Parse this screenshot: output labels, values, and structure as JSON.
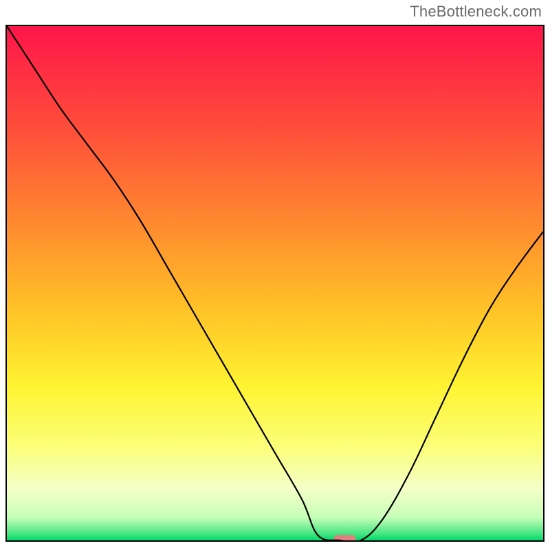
{
  "watermark": "TheBottleneck.com",
  "chart_data": {
    "type": "line",
    "title": "",
    "xlabel": "",
    "ylabel": "",
    "xlim": [
      0,
      100
    ],
    "ylim": [
      0,
      100
    ],
    "grid": false,
    "legend": false,
    "x": [
      0,
      5,
      10,
      15,
      20,
      25,
      30,
      35,
      40,
      45,
      50,
      55,
      58,
      62,
      66,
      70,
      75,
      80,
      85,
      90,
      95,
      100
    ],
    "values": [
      100,
      92,
      84,
      77,
      70,
      62,
      53,
      44,
      35,
      26,
      17,
      8,
      1,
      0,
      0,
      4,
      13,
      24,
      35,
      45,
      53,
      60
    ],
    "marker": {
      "x": 63,
      "y": 0,
      "color": "#e08080",
      "shape": "rounded-rect"
    },
    "gradient_stops": [
      {
        "offset": 0.0,
        "color": "#ff154a"
      },
      {
        "offset": 0.2,
        "color": "#ff4e3a"
      },
      {
        "offset": 0.4,
        "color": "#ff8f2e"
      },
      {
        "offset": 0.55,
        "color": "#ffc227"
      },
      {
        "offset": 0.7,
        "color": "#fff331"
      },
      {
        "offset": 0.82,
        "color": "#fbff7a"
      },
      {
        "offset": 0.9,
        "color": "#f4ffc8"
      },
      {
        "offset": 0.955,
        "color": "#c7ffb8"
      },
      {
        "offset": 0.985,
        "color": "#4fe886"
      },
      {
        "offset": 1.0,
        "color": "#00d968"
      }
    ]
  }
}
